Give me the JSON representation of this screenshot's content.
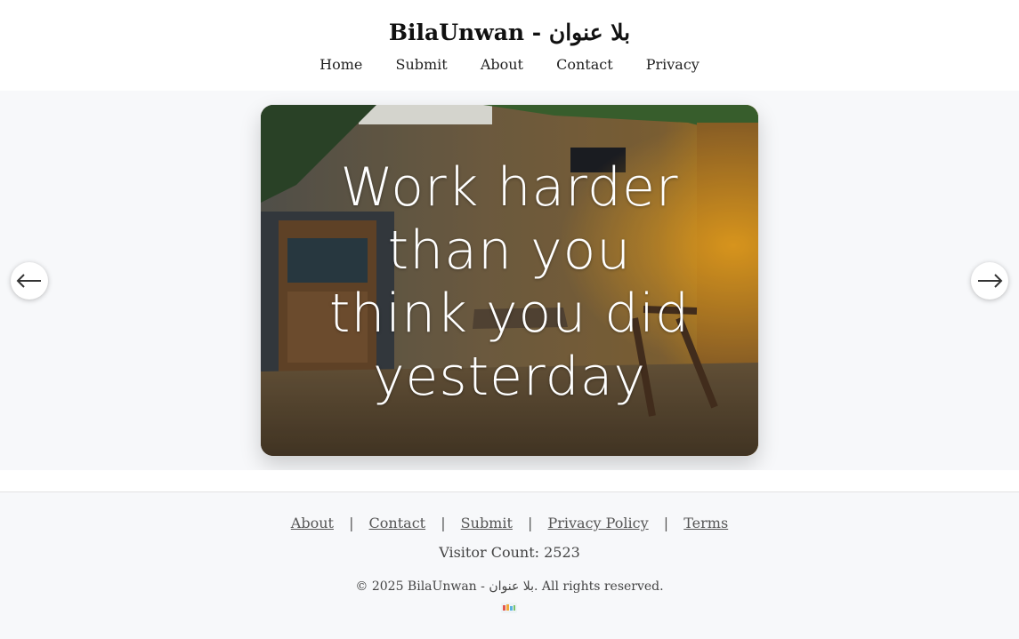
{
  "header": {
    "title": "BilaUnwan - بلا عنوان",
    "nav": [
      "Home",
      "Submit",
      "About",
      "Contact",
      "Privacy"
    ]
  },
  "slider": {
    "quote_lines": [
      "Work harder",
      "than you",
      "think you did",
      "yesterday"
    ],
    "prev_icon": "arrow-left-icon",
    "next_icon": "arrow-right-icon"
  },
  "footer": {
    "links": {
      "about": "About",
      "contact": "Contact",
      "submit": "Submit",
      "privacy": "Privacy Policy",
      "terms": "Terms"
    },
    "separator": "|",
    "visitor_count": "Visitor Count: 2523",
    "copyright": "© 2025 BilaUnwan - بلا عنوان. All rights reserved.",
    "badge_icon": "hit-counter-badge-icon"
  },
  "colors": {
    "header_bg": "#ffffff",
    "hero_bg": "#f7f8fa",
    "footer_bg": "#f7f8fa",
    "text": "#222222",
    "link_muted": "#555555"
  }
}
